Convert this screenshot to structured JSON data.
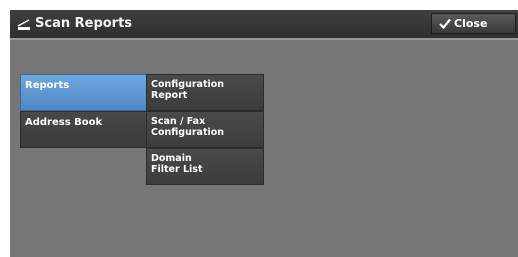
{
  "window": {
    "title": "Scan Reports",
    "close_label": "Close"
  },
  "categories": [
    {
      "label": "Reports",
      "selected": true
    },
    {
      "label": "Address Book",
      "selected": false
    }
  ],
  "reports": [
    {
      "line1": "Configuration",
      "line2": "Report"
    },
    {
      "line1": "Scan / Fax",
      "line2": "Configuration"
    },
    {
      "line1": "Domain",
      "line2": "Filter List"
    }
  ],
  "colors": {
    "accent_selected": "#5a93d2",
    "background": "#767676",
    "titlebar": "#383838"
  },
  "icons": {
    "title": "scanner-icon",
    "close": "checkmark-icon"
  }
}
